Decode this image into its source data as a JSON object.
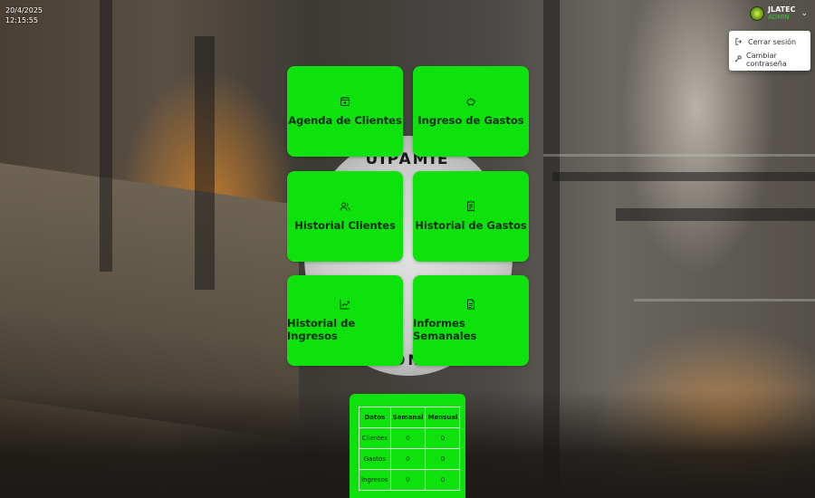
{
  "datetime": {
    "date": "20/4/2025",
    "time": "12:15:55"
  },
  "user": {
    "name": "JLATEC",
    "role": "ADMIN"
  },
  "dropdown": {
    "logout_label": "Cerrar sesión",
    "change_password_label": "Cambiar contraseña"
  },
  "background": {
    "logo_text_top": "UIPAMIE",
    "logo_text_bottom": "RONC"
  },
  "cards": [
    {
      "label": "Agenda de Clientes",
      "icon": "calendar-add-icon"
    },
    {
      "label": "Ingreso de Gastos",
      "icon": "piggy-bank-icon"
    },
    {
      "label": "Historial Clientes",
      "icon": "users-icon"
    },
    {
      "label": "Historial de Gastos",
      "icon": "receipt-icon"
    },
    {
      "label": "Historial de Ingresos",
      "icon": "chart-line-icon"
    },
    {
      "label": "Informes Semanales",
      "icon": "document-icon"
    }
  ],
  "summary": {
    "headers": [
      "Datos",
      "Semanal",
      "Mensual"
    ],
    "rows": [
      {
        "label": "Clientes",
        "semanal": "0",
        "mensual": "0"
      },
      {
        "label": "Gastos",
        "semanal": "0",
        "mensual": "0"
      },
      {
        "label": "Ingresos",
        "semanal": "0",
        "mensual": "0"
      }
    ]
  },
  "colors": {
    "card_green": "#0de20d",
    "role_green": "#23d823"
  }
}
